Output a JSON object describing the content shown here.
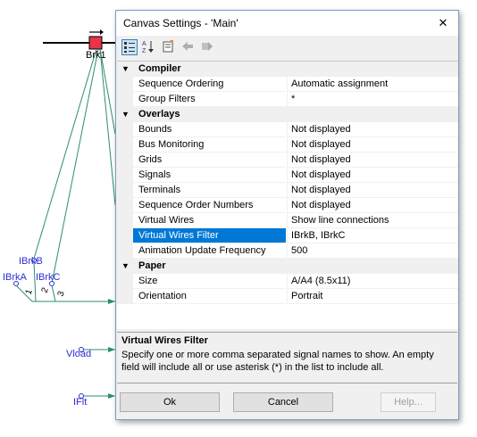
{
  "canvas": {
    "breaker_label": "Brk1",
    "signal_labels": [
      "IBrkB",
      "IBrkA",
      "IBrkC",
      "Vload",
      "IFlt"
    ],
    "wire_numbers": [
      "1",
      "2",
      "3"
    ]
  },
  "dialog": {
    "title": "Canvas Settings - 'Main'",
    "close_glyph": "✕",
    "toolbar": [
      "categorized-icon",
      "sort-alphabetical-icon",
      "property-pages-icon",
      "back-icon",
      "forward-icon"
    ],
    "categories": [
      {
        "name": "Compiler",
        "toggle": "▼",
        "properties": [
          {
            "name": "Sequence Ordering",
            "value": "Automatic assignment"
          },
          {
            "name": "Group Filters",
            "value": "*"
          }
        ]
      },
      {
        "name": "Overlays",
        "toggle": "▼",
        "properties": [
          {
            "name": "Bounds",
            "value": "Not displayed"
          },
          {
            "name": "Bus Monitoring",
            "value": "Not displayed"
          },
          {
            "name": "Grids",
            "value": "Not displayed"
          },
          {
            "name": "Signals",
            "value": "Not displayed"
          },
          {
            "name": "Terminals",
            "value": "Not displayed"
          },
          {
            "name": "Sequence Order Numbers",
            "value": "Not displayed"
          },
          {
            "name": "Virtual Wires",
            "value": "Show line connections"
          },
          {
            "name": "Virtual Wires Filter",
            "value": "IBrkB, IBrkC",
            "selected": true
          },
          {
            "name": "Animation Update Frequency",
            "value": "500"
          }
        ]
      },
      {
        "name": "Paper",
        "toggle": "▼",
        "properties": [
          {
            "name": "Size",
            "value": "A/A4 (8.5x11)"
          },
          {
            "name": "Orientation",
            "value": "Portrait"
          }
        ]
      }
    ],
    "description": {
      "title": "Virtual Wires Filter",
      "text": "Specify one or more comma separated signal names to show. An empty field will include all or use asterisk (*) in the list to include all."
    },
    "buttons": {
      "ok": "Ok",
      "cancel": "Cancel",
      "help": "Help..."
    },
    "colors": {
      "selection": "#0078d7",
      "wire": "#2e8b76",
      "signal_text": "#2b2bd6",
      "breaker": "#e8334a"
    }
  }
}
